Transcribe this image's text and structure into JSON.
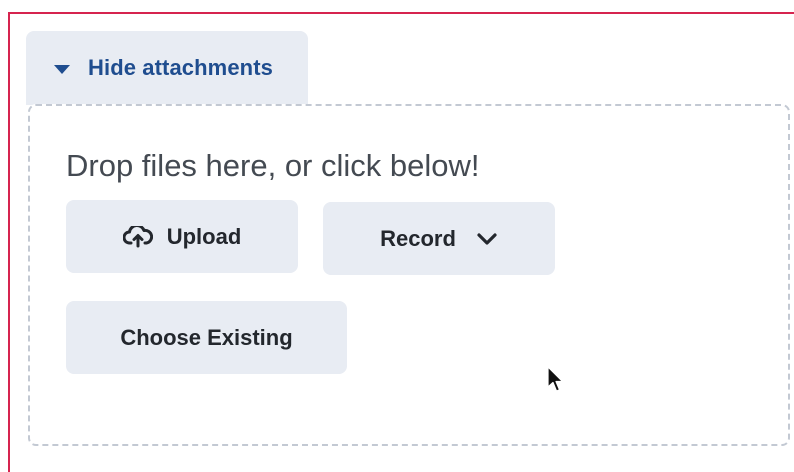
{
  "attachments": {
    "toggle_label": "Hide attachments",
    "toggle_icon": "caret-down-icon",
    "dropzone_text": "Drop files here, or click below!",
    "buttons": {
      "upload_label": "Upload",
      "upload_icon": "cloud-upload-icon",
      "record_label": "Record",
      "record_icon": "chevron-down-icon",
      "choose_existing_label": "Choose Existing"
    }
  },
  "colors": {
    "frame_border": "#d6244f",
    "toggle_text": "#1f4d8f",
    "button_bg": "#e8ecf3",
    "dropzone_border": "#c3c9d3"
  }
}
